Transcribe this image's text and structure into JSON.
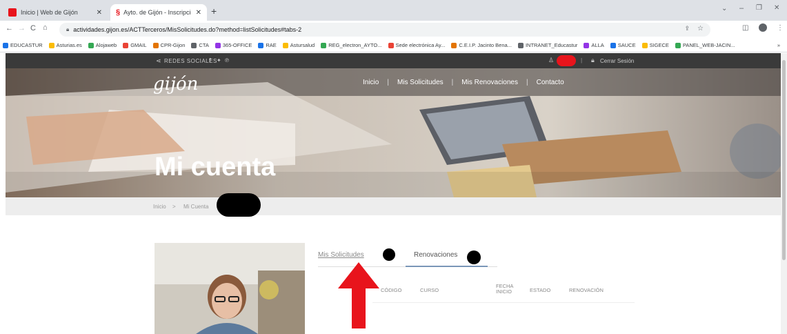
{
  "browser": {
    "tabs": [
      {
        "title": "Inicio | Web de Gijón",
        "active": false
      },
      {
        "title": "Ayto. de Gijón - Inscripción y re...",
        "active": true
      }
    ],
    "url": "actividades.gijon.es/ACTTerceros/MisSolicitudes.do?method=listSolicitudes#tabs-2",
    "bookmarks": [
      "EDUCASTUR",
      "Asturias.es",
      "Alojaweb",
      "GMAIL",
      "CPR-Gijon",
      "CTA",
      "365-OFFICE",
      "RAE",
      "Astursalud",
      "REG_electron_AYTO...",
      "Sede electrónica Ay...",
      "C.E.I.P. Jacinto Bena...",
      "INTRANET_Educastur",
      "ALLA",
      "SAUCE",
      "SIGECE",
      "PANEL_WEB-JACIN..."
    ],
    "more_bookmarks": "»"
  },
  "site": {
    "social_label": "REDES SOCIALES",
    "logout_label": "Cerrar Sesión",
    "logo": "gijón",
    "nav": [
      "Inicio",
      "Mis Solicitudes",
      "Mis Renovaciones",
      "Contacto"
    ],
    "hero_title": "Mi cuenta",
    "breadcrumb": [
      "Inicio",
      "Mi Cuenta"
    ],
    "breadcrumb_sep": ">",
    "tabs": [
      "Mis Solicitudes",
      "Renovaciones"
    ],
    "table_headers": [
      "CÓDIGO",
      "CURSO",
      "FECHA INICIO",
      "ESTADO",
      "RENOVACIÓN"
    ]
  },
  "colors": {
    "accent_red": "#e8141c",
    "topbar": "#3a3a3a",
    "tab_underline": "#7a96b8"
  }
}
